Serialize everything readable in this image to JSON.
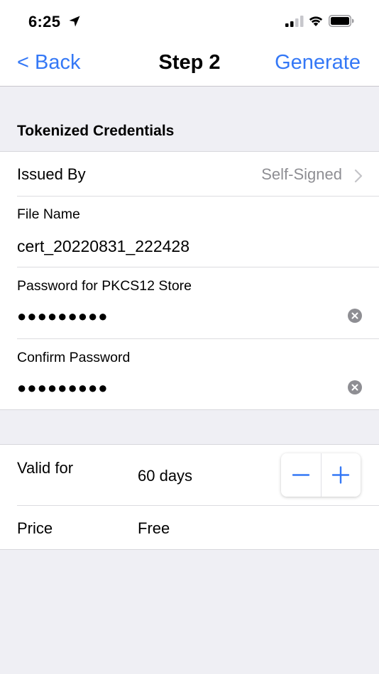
{
  "status_bar": {
    "time": "6:25",
    "icons": [
      "location-arrow-icon",
      "signal-icon",
      "wifi-icon",
      "battery-icon"
    ]
  },
  "nav": {
    "back_label": "< Back",
    "title": "Step 2",
    "action_label": "Generate"
  },
  "section": {
    "header": "Tokenized Credentials"
  },
  "issued_by": {
    "label": "Issued By",
    "value": "Self-Signed"
  },
  "file_name": {
    "label": "File Name",
    "value": "cert_20220831_222428"
  },
  "password": {
    "label": "Password for PKCS12 Store",
    "masked_value": "●●●●●●●●●"
  },
  "confirm_password": {
    "label": "Confirm Password",
    "masked_value": "●●●●●●●●●"
  },
  "valid_for": {
    "label": "Valid for",
    "value": "60 days",
    "decrement_label": "−",
    "increment_label": "+"
  },
  "price": {
    "label": "Price",
    "value": "Free"
  },
  "colors": {
    "accent": "#3478f6",
    "secondary_text": "#8e8e93",
    "grouped_background": "#efeff4"
  }
}
